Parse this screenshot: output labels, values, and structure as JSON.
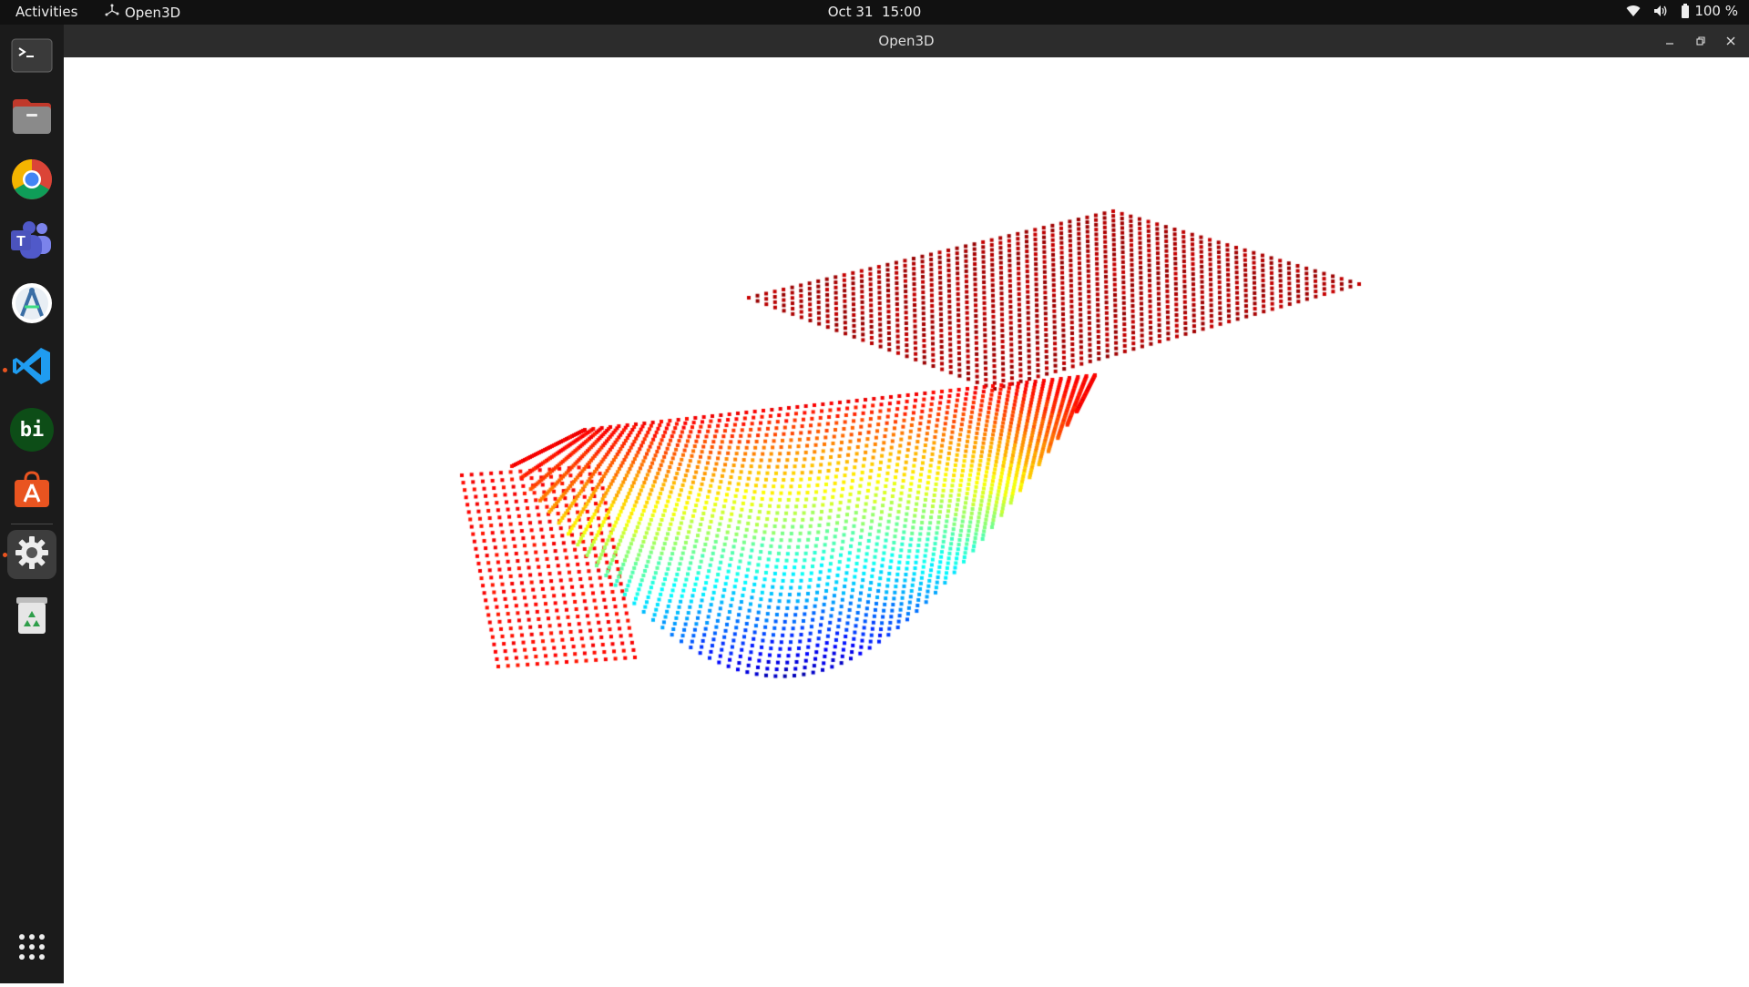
{
  "topbar": {
    "activities": "Activities",
    "app_name": "Open3D",
    "clock": "Oct 31  15:00",
    "battery": "100 %"
  },
  "dock": {
    "items": [
      {
        "name": "terminal",
        "icon": "terminal-icon"
      },
      {
        "name": "files",
        "icon": "folder-icon"
      },
      {
        "name": "chrome",
        "icon": "chrome-icon"
      },
      {
        "name": "teams",
        "icon": "teams-icon"
      },
      {
        "name": "android-studio",
        "icon": "android-studio-icon"
      },
      {
        "name": "vscode",
        "icon": "vscode-icon"
      },
      {
        "name": "bi",
        "icon": "bi-icon",
        "label": "bi"
      },
      {
        "name": "app-center",
        "icon": "shopping-bag-icon"
      },
      {
        "name": "settings",
        "icon": "gear-icon"
      },
      {
        "name": "trash",
        "icon": "trash-icon"
      },
      {
        "name": "show-apps",
        "icon": "grid-icon"
      }
    ]
  },
  "window": {
    "title": "Open3D"
  },
  "colors": {
    "topbar": "#111111",
    "dock": "#1b1b1b",
    "titlebar": "#2c2c2c",
    "accent": "#e95420",
    "viewport": "#ffffff"
  }
}
